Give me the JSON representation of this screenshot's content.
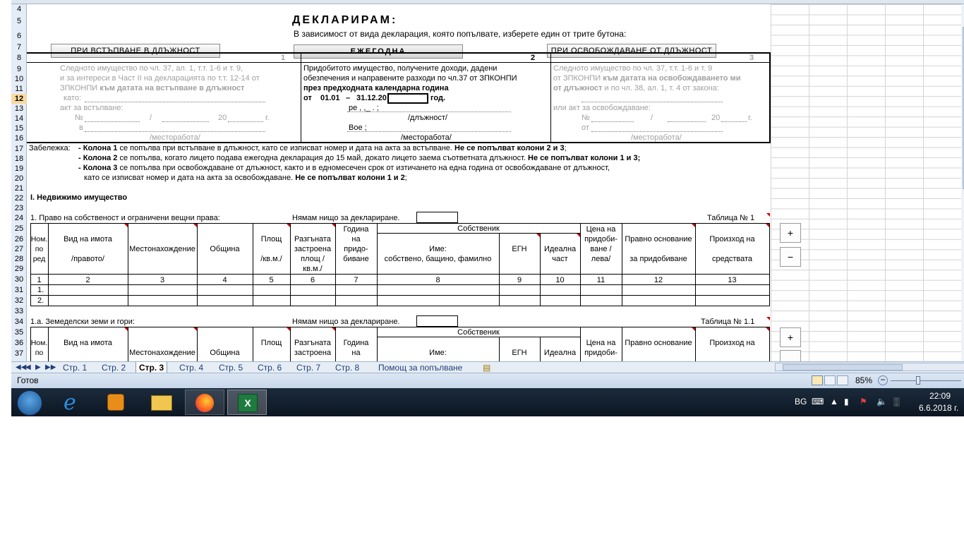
{
  "document": {
    "title": "ДЕКЛАРИРАМ:",
    "subtitle": "В зависимост от вида декларация, която попълвате, изберете един от трите бутона:",
    "buttons": {
      "b1": "ПРИ ВСТЪПВАНЕ В ДЛЪЖНОСТ",
      "b2": "ЕЖЕГОДНА",
      "b3": "ПРИ ОСВОБОЖДАВАНЕ ОТ ДЛЪЖНОСТ"
    },
    "colnums": {
      "c1": "1",
      "c2": "2",
      "c3": "3"
    },
    "col1": {
      "l1": "Следното имущество по чл. 37, ал. 1, т.т. 1-6 и т. 9,",
      "l2": "и за интереси в Част II на декларацията по т.т. 12-14 от",
      "l3a": "ЗПКОНПИ ",
      "l3b": "към датата на встъпване в длъжност",
      "l4": "като:",
      "l5": "акт за встъпване:",
      "l6a": "№",
      "l6b": "/",
      "l6c": "20",
      "l6d": "г.",
      "l7": "в",
      "l8": "/месторабота/"
    },
    "col2": {
      "l1": "Придобитото имущество, получените доходи, дадени",
      "l2": "обезпечения и направените разходи по чл.37 от ЗПКОНПИ",
      "l3": "през предходната календарна година",
      "l4a": "от",
      "l4b": "01.01",
      "l4c": "–",
      "l4d": "31.12.20",
      "l4e": "год.",
      "l5": "ре   ,   ,_ .   ;",
      "l6": "/длъжност/",
      "l7": "Вое    ;",
      "l8": "/месторабота/"
    },
    "col3": {
      "l1": "Следното имущество по чл. 37, т.т. 1-6 и т. 9",
      "l2a": "от ЗПКОНПИ ",
      "l2b": "към датата на освобождаването ми",
      "l3a": "от длъжност",
      "l3b": " и по чл. 38, ал. 1, т. 4 от закона:",
      "l5": "или акт за освобождаване:",
      "l6a": "№",
      "l6b": "/",
      "l6c": "20",
      "l6d": "г.",
      "l7": "от",
      "l8": "/месторабота/"
    },
    "notes": {
      "label": "Забележка:",
      "n1a": "- ",
      "n1b": "Колона 1",
      "n1c": " се попълва при встъпване в длъжност, като се изписват номер и дата на акта за встъпване. ",
      "n1d": "Не се попълват колони 2 и 3",
      "n1e": ";",
      "n2a": "- ",
      "n2b": "Колона 2",
      "n2c": " се попълва, когато лицето подава ежегодна декларация до 15 май, докато лицето заема съответната длъжност. ",
      "n2d": "Не се попълват колони 1 и 3;",
      "n3a": "- ",
      "n3b": "Колона 3",
      "n3c": " се попълва при освобождаване от длъжност, както и в едномесечен срок от изтичането на една година от освобождаване от длъжност,",
      "n4a": "като се изписват номер и дата на акта за освобождаване. ",
      "n4b": "Не се попълват колони 1 и 2",
      "n4c": ";"
    },
    "section1": "I. Недвижимо имущество",
    "t1": {
      "caption": "1. Право на собственост и ограничени вещни права:",
      "nothing": "Нямам нищо за деклариране.",
      "table_no": "Таблица  № 1",
      "headers": {
        "nom": "Ном. по ред",
        "vid1": "Вид на имота",
        "vid2": "/правото/",
        "mesto": "Местонахождение",
        "obshtina": "Община",
        "plosht1": "Площ",
        "plosht2": "/кв.м./",
        "razg": "Разгъната застроена площ /кв.м./",
        "godina": "Година на придо- биване",
        "sobst": "Собственик",
        "ime1": "Име:",
        "ime2": "собствено, бащино, фамилно",
        "egn": "ЕГН",
        "ideal": "Идеална част",
        "cena": "Цена на придоби- ване /лева/",
        "pravno1": "Правно основание",
        "pravno2": "за придобиване",
        "proizhod1": "Произход на",
        "proizhod2": "средствата"
      },
      "colnums": [
        "1",
        "2",
        "3",
        "4",
        "5",
        "6",
        "7",
        "8",
        "9",
        "10",
        "11",
        "12",
        "13"
      ],
      "rows": [
        "1.",
        "2."
      ]
    },
    "t2": {
      "caption": "1.а. Земеделски земи и гори:",
      "nothing": "Нямам нищо за деклариране.",
      "table_no": "Таблица  № 1.1",
      "headers": {
        "nom": "Ном. по",
        "vid1": "Вид на имота",
        "mesto": "Местонахождение",
        "obshtina": "Община",
        "plosht1": "Площ",
        "razg": "Разгъната застроена",
        "godina": "Година на",
        "sobst": "Собственик",
        "ime1": "Име:",
        "egn": "ЕГН",
        "ideal": "Идеална",
        "cena": "Цена на придоби-",
        "pravno1": "Правно основание",
        "proizhod1": "Произход на"
      }
    },
    "side_buttons": {
      "plus": "+",
      "minus": "−",
      "plus2": "+"
    }
  },
  "row_numbers": [
    "4",
    "5",
    "6",
    "7",
    "8",
    "9",
    "10",
    "11",
    "12",
    "13",
    "14",
    "15",
    "16",
    "17",
    "18",
    "19",
    "20",
    "21",
    "22",
    "23",
    "24",
    "25",
    "26",
    "27",
    "28",
    "29",
    "30",
    "31",
    "32",
    "33",
    "34",
    "35",
    "36",
    "37"
  ],
  "sheet_tabs": [
    "Стр. 1",
    "Стр. 2",
    "Стр. 3",
    "Стр. 4",
    "Стр. 5",
    "Стр. 6",
    "Стр. 7",
    "Стр. 8",
    "Помощ за попълване"
  ],
  "active_tab": "Стр. 3",
  "status": {
    "ready": "Готов",
    "zoom": "85%"
  },
  "taskbar": {
    "lang": "BG",
    "time": "22:09",
    "date": "6.6.2018 г."
  }
}
